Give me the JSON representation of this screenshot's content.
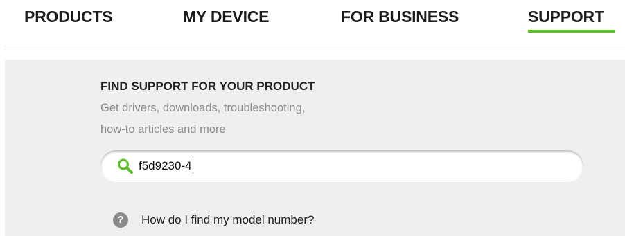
{
  "nav": {
    "items": [
      {
        "label": "PRODUCTS"
      },
      {
        "label": "MY DEVICE"
      },
      {
        "label": "FOR BUSINESS"
      },
      {
        "label": "SUPPORT",
        "active": true
      }
    ],
    "active_color": "#5cbf2a"
  },
  "support": {
    "title": "FIND SUPPORT FOR YOUR PRODUCT",
    "subtitle_line1": "Get drivers, downloads, troubleshooting,",
    "subtitle_line2": "how-to articles and more",
    "search": {
      "value": "f5d9230-4",
      "icon": "search-icon",
      "icon_color": "#5cbf2a"
    },
    "help": {
      "icon": "question-icon",
      "icon_glyph": "?",
      "label": "How do I find my model number?"
    }
  }
}
